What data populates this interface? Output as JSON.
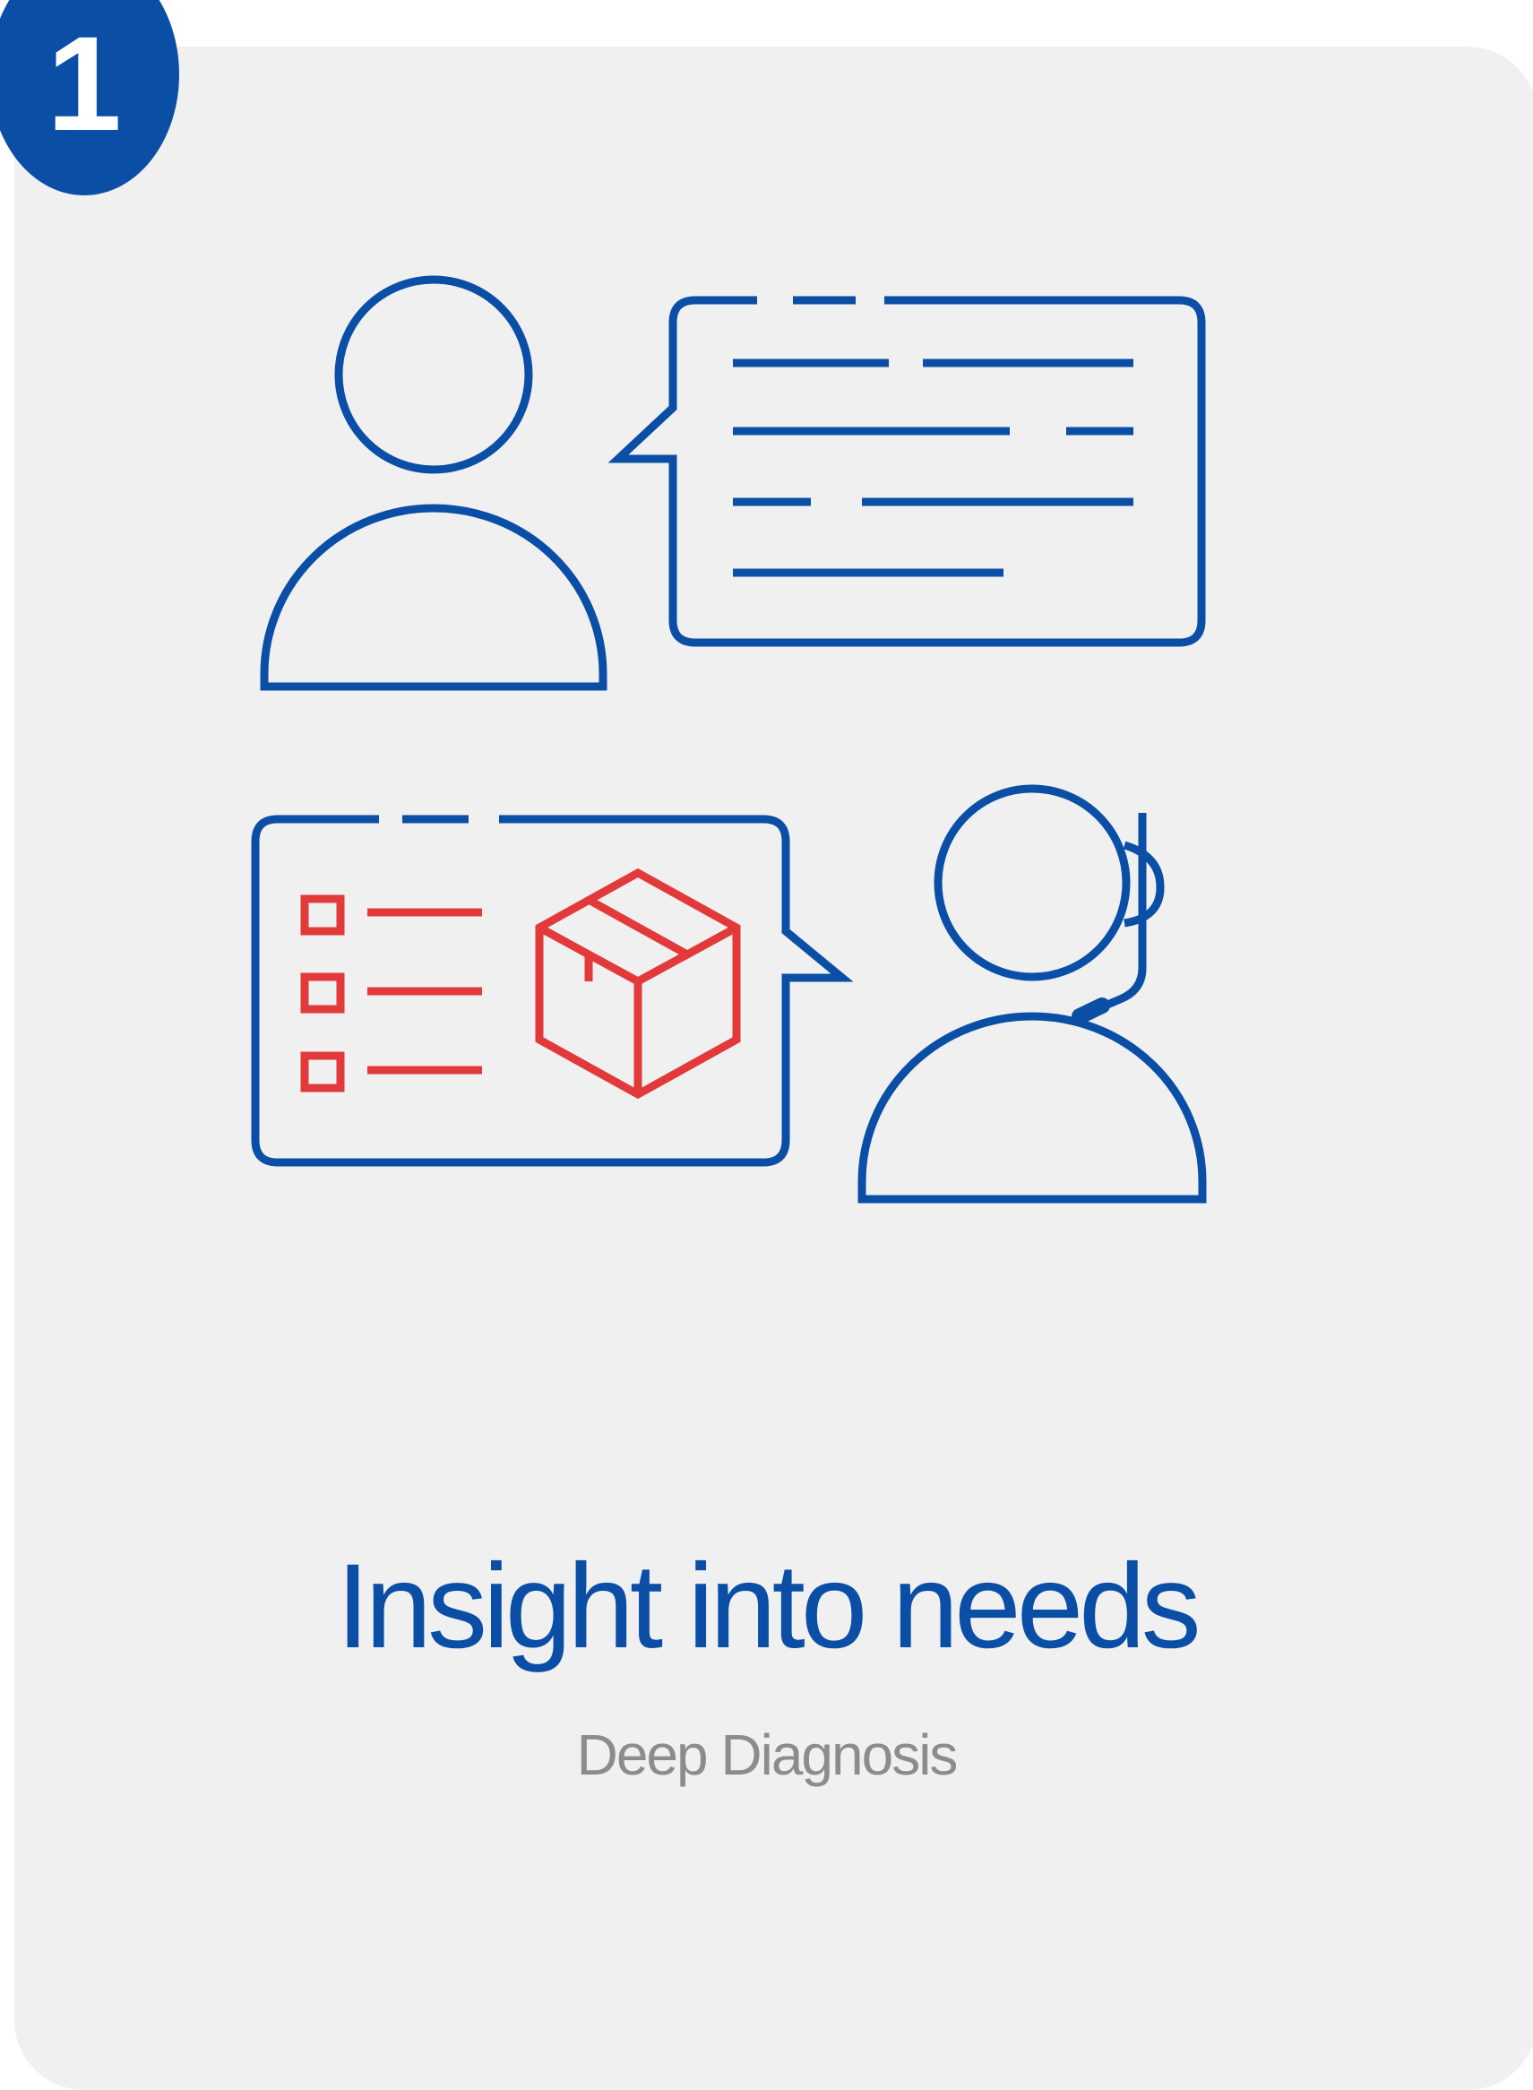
{
  "step_number": "1",
  "title": "Insight into needs",
  "subtitle": "Deep Diagnosis",
  "colors": {
    "primary": "#0a4ea6",
    "accent": "#e23a3a",
    "card_background": "#f0f0f0",
    "subtitle_text": "#8c8c8c"
  },
  "icons": {
    "customer": "person-icon",
    "customer_message": "speech-bubble-icon",
    "agent": "support-agent-headset-icon",
    "agent_message": "checklist-product-bubble-icon",
    "product": "package-box-icon"
  }
}
